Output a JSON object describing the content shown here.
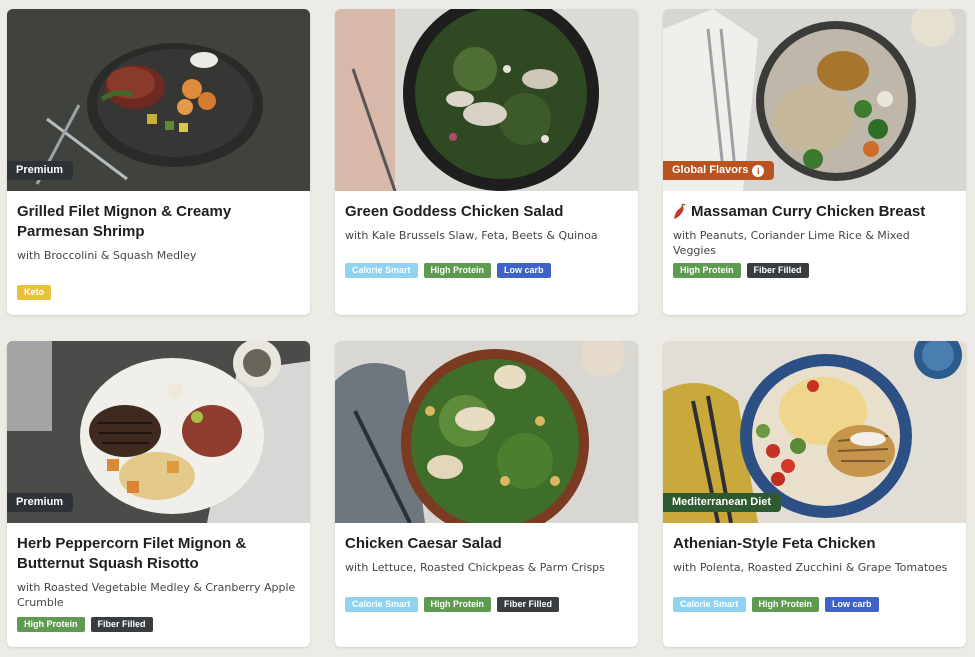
{
  "colors": {
    "background": "#ecebe6",
    "tag_keto": "#e9c23c",
    "tag_calorie_smart": "#8fd3f0",
    "tag_high_protein": "#5e9a4f",
    "tag_low_carb": "#3e62c5",
    "tag_fiber_filled": "#3a3d40",
    "pill_premium": "#2f3337",
    "pill_global": "#b9531f",
    "pill_mediterranean": "#2e5a32"
  },
  "meals": [
    {
      "title": "Grilled Filet Mignon & Creamy Parmesan Shrimp",
      "subtitle": "with Broccolini & Squash Medley",
      "badge": "Premium",
      "tags": [
        "Keto"
      ]
    },
    {
      "title": "Green Goddess Chicken Salad",
      "subtitle": "with Kale Brussels Slaw, Feta, Beets & Quinoa",
      "badge": "",
      "tags": [
        "Calorie Smart",
        "High Protein",
        "Low carb"
      ]
    },
    {
      "title": "Massaman Curry Chicken Breast",
      "subtitle": "with Peanuts, Coriander Lime Rice & Mixed Veggies",
      "badge": "Global Flavors",
      "badge_icon": "info-icon",
      "title_icon": "chili-pepper-icon",
      "tags": [
        "High Protein",
        "Fiber Filled"
      ]
    },
    {
      "title": "Herb Peppercorn Filet Mignon & Butternut Squash Risotto",
      "subtitle": "with Roasted Vegetable Medley & Cranberry Apple Crumble",
      "badge": "Premium",
      "tags": [
        "High Protein",
        "Fiber Filled"
      ]
    },
    {
      "title": "Chicken Caesar Salad",
      "subtitle": "with Lettuce, Roasted Chickpeas & Parm Crisps",
      "badge": "",
      "tags": [
        "Calorie Smart",
        "High Protein",
        "Fiber Filled"
      ]
    },
    {
      "title": "Athenian-Style Feta Chicken",
      "subtitle": "with Polenta, Roasted Zucchini & Grape Tomatoes",
      "badge": "Mediterranean Diet",
      "tags": [
        "Calorie Smart",
        "High Protein",
        "Low carb"
      ]
    }
  ]
}
